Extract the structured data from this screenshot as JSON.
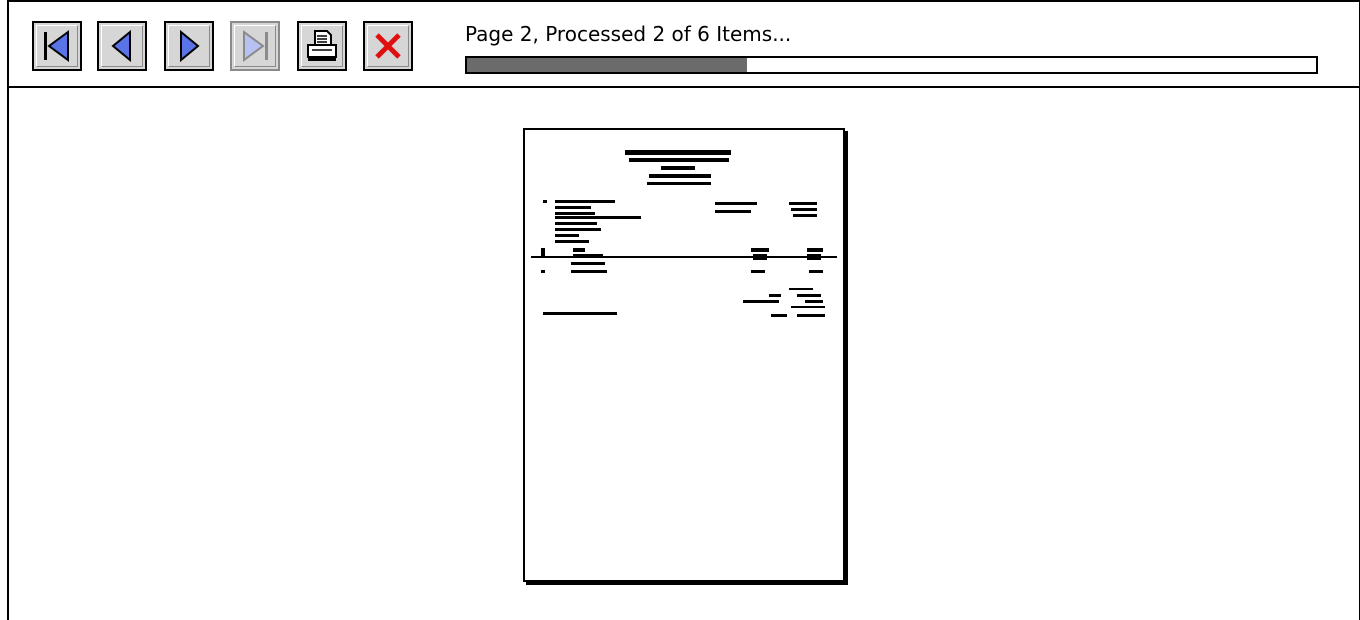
{
  "status": {
    "text": "Page 2, Processed 2 of 6 Items...",
    "progress": 0.33
  },
  "toolbar": {
    "buttons": [
      {
        "name": "first-page",
        "icon": "first-page-icon",
        "enabled": true
      },
      {
        "name": "previous-page",
        "icon": "previous-page-icon",
        "enabled": true
      },
      {
        "name": "next-page",
        "icon": "next-page-icon",
        "enabled": true
      },
      {
        "name": "last-page",
        "icon": "last-page-icon",
        "enabled": false
      },
      {
        "name": "print",
        "icon": "printer-icon",
        "enabled": true
      },
      {
        "name": "close",
        "icon": "close-icon",
        "enabled": true
      }
    ]
  },
  "colors": {
    "nav_arrow": "#5a73e6",
    "nav_arrow_disabled": "#b7c2f2",
    "close_x": "#e01010",
    "progress_fill": "#6b6b6b",
    "button_face": "#d6d6d6"
  }
}
